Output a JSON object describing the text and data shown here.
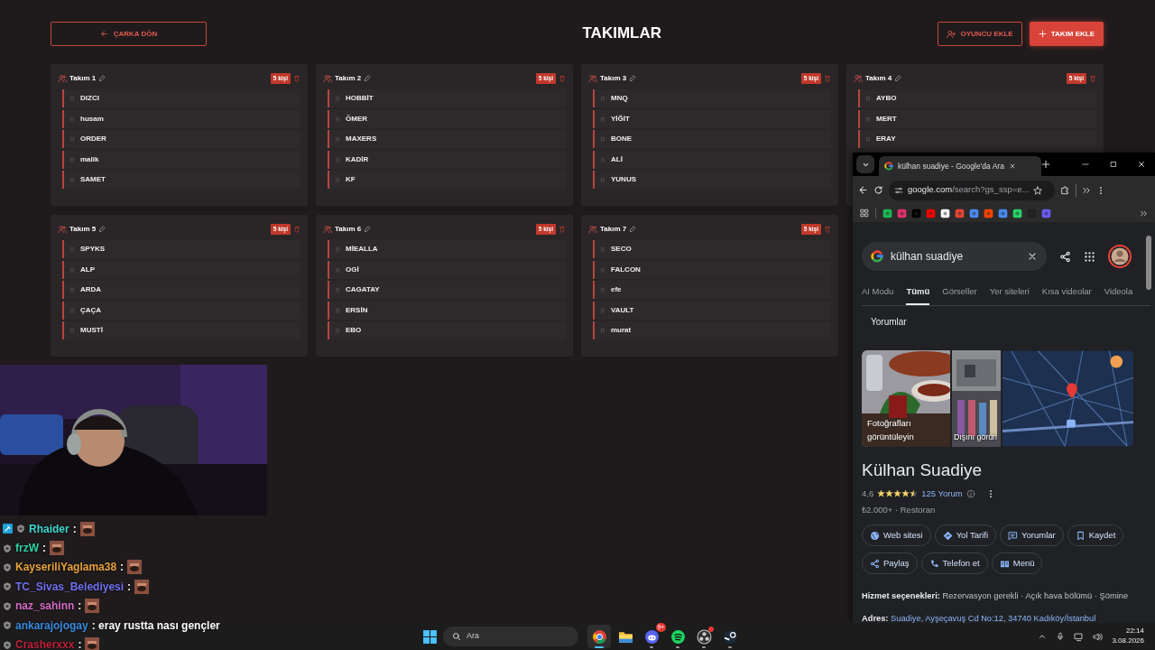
{
  "header": {
    "back_label": "ÇARKA DÖN",
    "title": "TAKIMLAR",
    "add_player_label": "OYUNCU EKLE",
    "add_team_label": "TAKIM EKLE"
  },
  "teams": [
    {
      "name": "Takım 1",
      "count": "5 kişi",
      "players": [
        "DIZCI",
        "husam",
        "ORDER",
        "malik",
        "SAMET"
      ]
    },
    {
      "name": "Takım 2",
      "count": "5 kişi",
      "players": [
        "HOBBİT",
        "ÖMER",
        "MAXERS",
        "KADİR",
        "KF"
      ]
    },
    {
      "name": "Takım 3",
      "count": "5 kişi",
      "players": [
        "MNQ",
        "YİĞİT",
        "BONE",
        "ALİ",
        "YUNUS"
      ]
    },
    {
      "name": "Takım 4",
      "count": "5 kişi",
      "players": [
        "AYBO",
        "MERT",
        "ERAY"
      ]
    },
    {
      "name": "Takım 5",
      "count": "5 kişi",
      "players": [
        "SPYKS",
        "ALP",
        "ARDA",
        "ÇAÇA",
        "MUSTİ"
      ]
    },
    {
      "name": "Takım 6",
      "count": "5 kişi",
      "players": [
        "MİEALLA",
        "OGİ",
        "CAGATAY",
        "ERSİN",
        "EBO"
      ]
    },
    {
      "name": "Takım 7",
      "count": "5 kişi",
      "players": [
        "SECO",
        "FALCON",
        "efe",
        "VAULT",
        "murat"
      ]
    }
  ],
  "chat": [
    {
      "user": "Rhaider",
      "color": "#3fd6d0",
      "moderator": true,
      "kind": "emote",
      "text": ":"
    },
    {
      "user": "frzW",
      "color": "#2fd3a0",
      "moderator": false,
      "kind": "emote",
      "text": ":"
    },
    {
      "user": "KayseriliYaglama38",
      "color": "#e8a33a",
      "moderator": false,
      "kind": "emote",
      "text": ":"
    },
    {
      "user": "TC_Sivas_Belediyesi",
      "color": "#7070f0",
      "moderator": false,
      "kind": "emote",
      "text": ":"
    },
    {
      "user": "naz_sahinn",
      "color": "#d66bc8",
      "moderator": false,
      "kind": "emote",
      "text": ":"
    },
    {
      "user": "ankarajojogay",
      "color": "#3a8ae0",
      "moderator": false,
      "kind": "text",
      "text": ": eray rustta nası gençler"
    },
    {
      "user": "Crasherxxx",
      "color": "#c0203a",
      "moderator": false,
      "kind": "emote",
      "text": ":"
    }
  ],
  "browser": {
    "tab_title": "külhan suadiye - Google'da Ara",
    "url_host": "google.com",
    "url_path": "/search?gs_ssp=e...",
    "query": "külhan suadiye",
    "search_tabs": [
      {
        "label": "AI Modu",
        "selected": false
      },
      {
        "label": "Tümü",
        "selected": true
      },
      {
        "label": "Görseller",
        "selected": false
      },
      {
        "label": "Yer siteleri",
        "selected": false
      },
      {
        "label": "Kısa videolar",
        "selected": false
      },
      {
        "label": "Videola",
        "selected": false
      }
    ],
    "section": "Yorumlar",
    "photo_captions": [
      "Fotoğrafları görüntüleyin",
      "Dışını görün"
    ],
    "place": {
      "name": "Külhan Suadiye",
      "rating": "4,6",
      "stars": 4.5,
      "reviews": "125 Yorum",
      "price": "₺2.000+ · Restoran"
    },
    "actions": [
      {
        "kind": "website",
        "label": "Web sitesi"
      },
      {
        "kind": "directions",
        "label": "Yol Tarifi"
      },
      {
        "kind": "reviews",
        "label": "Yorumlar"
      },
      {
        "kind": "save",
        "label": "Kaydet"
      },
      {
        "kind": "share",
        "label": "Paylaş"
      },
      {
        "kind": "phone",
        "label": "Telefon et"
      },
      {
        "kind": "menu",
        "label": "Menü"
      }
    ],
    "details": [
      {
        "label": "Hizmet seçenekleri:",
        "value": "Rezervasyon gerekli · Açık hava bölümü · Şömine",
        "link": false
      },
      {
        "label": "Adres:",
        "value": "Suadiye, Ayşeçavuş Cd No:12, 34740 Kadıköy/İstanbul",
        "link": true
      }
    ]
  },
  "taskbar": {
    "search_placeholder": "Ara",
    "apps": [
      {
        "kind": "browser",
        "active": true
      },
      {
        "kind": "folder",
        "active": false,
        "running": false
      },
      {
        "kind": "chat",
        "active": false,
        "running": true,
        "badge": "9+"
      },
      {
        "kind": "music",
        "active": false,
        "running": true
      },
      {
        "kind": "recorder",
        "active": false,
        "running": true,
        "alert": true
      },
      {
        "kind": "game",
        "active": false,
        "running": true
      }
    ],
    "time": "22:14",
    "date": "3.08.2026"
  }
}
